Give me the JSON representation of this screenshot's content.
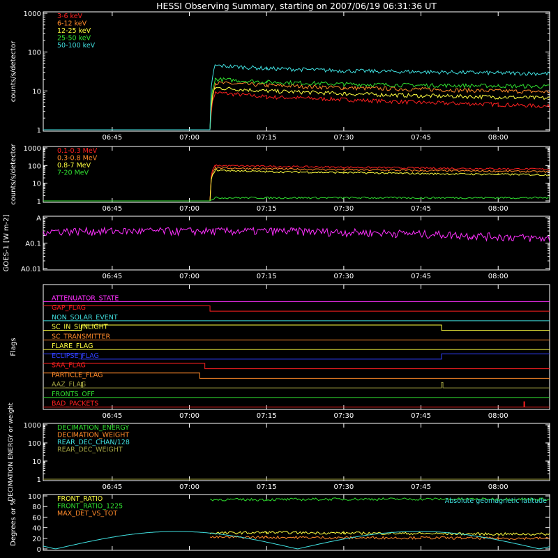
{
  "title": "HESSI Observing Summary, starting on 2007/06/19 06:31:36 UT",
  "x_ticks": [
    "06:45",
    "07:00",
    "07:15",
    "07:30",
    "07:45",
    "08:00"
  ],
  "chart_data": [
    {
      "type": "line",
      "ylabel": "counts/s/detector",
      "yscale": "log",
      "ylim": [
        1,
        1000
      ],
      "y_ticks": [
        "1",
        "10",
        "100",
        "1000"
      ],
      "xlim": [
        "06:31:36",
        "08:10"
      ],
      "legend_position": "top-left",
      "series": [
        {
          "name": "3-6 keV",
          "color": "#ff2020",
          "x": [
            "06:31:36",
            "07:04",
            "07:05",
            "07:15",
            "07:30",
            "07:45",
            "08:00",
            "08:10"
          ],
          "y": [
            1,
            1,
            9,
            7,
            6,
            5,
            4.5,
            4
          ]
        },
        {
          "name": "6-12 keV",
          "color": "#ff8a2a",
          "x": [
            "06:31:36",
            "07:04",
            "07:05",
            "07:15",
            "07:30",
            "07:45",
            "08:00",
            "08:10"
          ],
          "y": [
            1,
            1,
            16,
            14,
            12,
            11,
            10,
            9.5
          ]
        },
        {
          "name": "12-25 keV",
          "color": "#ffff40",
          "x": [
            "06:31:36",
            "07:04",
            "07:05",
            "07:15",
            "07:30",
            "07:45",
            "08:00",
            "08:10"
          ],
          "y": [
            1,
            1,
            12,
            10,
            8.5,
            7.5,
            7,
            6.5
          ]
        },
        {
          "name": "25-50 keV",
          "color": "#30e030",
          "x": [
            "06:31:36",
            "07:04",
            "07:05",
            "07:15",
            "07:30",
            "07:45",
            "08:00",
            "08:10"
          ],
          "y": [
            1,
            1,
            20,
            17,
            15,
            14,
            13.5,
            13
          ]
        },
        {
          "name": "50-100 keV",
          "color": "#40e0e0",
          "x": [
            "06:31:36",
            "07:04",
            "07:05",
            "07:15",
            "07:30",
            "07:45",
            "08:00",
            "08:10"
          ],
          "y": [
            1,
            1,
            45,
            38,
            33,
            31,
            29,
            28
          ]
        }
      ]
    },
    {
      "type": "line",
      "ylabel": "counts/s/detector",
      "yscale": "log",
      "ylim": [
        1,
        1000
      ],
      "y_ticks": [
        "1",
        "10",
        "100",
        "1000"
      ],
      "legend_position": "top-left",
      "series": [
        {
          "name": "0.1-0.3 MeV",
          "color": "#ff2020",
          "x": [
            "06:31:36",
            "07:04",
            "07:05",
            "07:15",
            "07:30",
            "07:45",
            "08:00",
            "08:10"
          ],
          "y": [
            1,
            1,
            100,
            90,
            80,
            72,
            66,
            62
          ]
        },
        {
          "name": "0.3-0.8 MeV",
          "color": "#ff8a2a",
          "x": [
            "06:31:36",
            "07:04",
            "07:05",
            "07:15",
            "07:30",
            "07:45",
            "08:00",
            "08:10"
          ],
          "y": [
            1,
            1,
            75,
            65,
            58,
            52,
            48,
            45
          ]
        },
        {
          "name": "0.8-7 MeV",
          "color": "#ffff40",
          "x": [
            "06:31:36",
            "07:04",
            "07:05",
            "07:15",
            "07:30",
            "07:45",
            "08:00",
            "08:10"
          ],
          "y": [
            1,
            1,
            55,
            45,
            40,
            35,
            32,
            30
          ]
        },
        {
          "name": "7-20 MeV",
          "color": "#30e030",
          "x": [
            "06:31:36",
            "07:04",
            "07:05",
            "07:15",
            "07:30",
            "07:45",
            "08:00",
            "08:10"
          ],
          "y": [
            1,
            1,
            1.5,
            1.5,
            1.5,
            1.5,
            1.5,
            1.5
          ]
        }
      ]
    },
    {
      "type": "line",
      "ylabel": "GOES-1 [W m-2]",
      "yscale": "log",
      "y_ticks": [
        "A0.01",
        "A0.1",
        "A"
      ],
      "series": [
        {
          "name": "",
          "color": "#ff30ff",
          "x": [
            "06:31:36",
            "07:20",
            "07:40",
            "07:55",
            "08:10"
          ],
          "y": [
            0.3,
            0.3,
            0.25,
            0.2,
            0.15
          ]
        }
      ]
    },
    {
      "type": "flags",
      "ylabel": "Flags",
      "flags": [
        {
          "name": "ATTENUATOR_STATE",
          "color": "#ff30ff"
        },
        {
          "name": "GAP_FLAG",
          "color": "#ff2020"
        },
        {
          "name": "NON_SOLAR_EVENT",
          "color": "#40e0e0"
        },
        {
          "name": "SC_IN_SUNLIGHT",
          "color": "#ffff40"
        },
        {
          "name": "SC_TRANSMITTER",
          "color": "#ff8a2a"
        },
        {
          "name": "FLARE_FLAG",
          "color": "#ffff40"
        },
        {
          "name": "ECLIPSE_FLAG",
          "color": "#3040ff"
        },
        {
          "name": "SAA_FLAG",
          "color": "#ff2020"
        },
        {
          "name": "PARTICLE_FLAG",
          "color": "#ff8a2a"
        },
        {
          "name": "AAZ_FLAG",
          "color": "#a0a040"
        },
        {
          "name": "FRONTS_OFF",
          "color": "#30e030"
        },
        {
          "name": "BAD_PACKETS",
          "color": "#ff2020"
        }
      ]
    },
    {
      "type": "line",
      "ylabel": "DECIMATION ENERGY or weight",
      "yscale": "log",
      "ylim": [
        1,
        1000
      ],
      "y_ticks": [
        "1",
        "10",
        "100",
        "1000"
      ],
      "legend_position": "top-left",
      "series": [
        {
          "name": "DECIMATION_ENERGY",
          "color": "#30e030"
        },
        {
          "name": "DECIMATION_WEIGHT",
          "color": "#ff8a2a"
        },
        {
          "name": "REAR_DEC_CHAN/128",
          "color": "#40e0e0"
        },
        {
          "name": "REAR_DEC_WEIGHT",
          "color": "#a0a040"
        }
      ]
    },
    {
      "type": "line",
      "ylabel": "Degrees or %",
      "ylim": [
        0,
        100
      ],
      "y_ticks": [
        "0",
        "20",
        "40",
        "60",
        "80",
        "100"
      ],
      "legend_position": "top-left",
      "annotation": "Absolute geomagnetic latitude",
      "series": [
        {
          "name": "FRONT_RATIO",
          "color": "#ffff40",
          "x": [
            "07:04",
            "07:15",
            "07:30",
            "07:45",
            "08:00",
            "08:10"
          ],
          "y": [
            30,
            31,
            30,
            29,
            28,
            28
          ]
        },
        {
          "name": "FRONT_RATIO_1225",
          "color": "#30e030",
          "x": [
            "07:04",
            "07:15",
            "07:30",
            "07:45",
            "08:00",
            "08:10"
          ],
          "y": [
            93,
            93,
            94,
            94,
            94,
            94
          ]
        },
        {
          "name": "MAX_DET_VS_TOT",
          "color": "#ff8a2a",
          "x": [
            "07:04",
            "07:15",
            "07:30",
            "07:45",
            "08:00",
            "08:10"
          ],
          "y": [
            22,
            22,
            21,
            21,
            20,
            20
          ]
        }
      ]
    }
  ]
}
